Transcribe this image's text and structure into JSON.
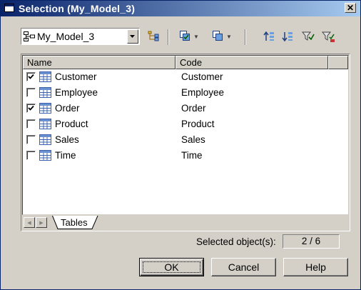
{
  "window": {
    "title": "Selection (My_Model_3)",
    "close_label": "✕"
  },
  "toolbar": {
    "model_value": "My_Model_3",
    "icons": [
      "model-tree-icon",
      "hierarchy-icon",
      "select-all-icon",
      "deselect-all-icon",
      "move-up-icon",
      "move-down-icon",
      "filter-icon",
      "clear-filter-icon"
    ]
  },
  "list": {
    "columns": [
      "Name",
      "Code"
    ],
    "rows": [
      {
        "name": "Customer",
        "code": "Customer",
        "checked": true
      },
      {
        "name": "Employee",
        "code": "Employee",
        "checked": false
      },
      {
        "name": "Order",
        "code": "Order",
        "checked": true
      },
      {
        "name": "Product",
        "code": "Product",
        "checked": false
      },
      {
        "name": "Sales",
        "code": "Sales",
        "checked": false
      },
      {
        "name": "Time",
        "code": "Time",
        "checked": false
      }
    ]
  },
  "tabs": [
    {
      "label": "Tables"
    }
  ],
  "status": {
    "selected_label": "Selected object(s):",
    "selected_value": "2 / 6"
  },
  "buttons": {
    "ok": "OK",
    "cancel": "Cancel",
    "help": "Help"
  }
}
